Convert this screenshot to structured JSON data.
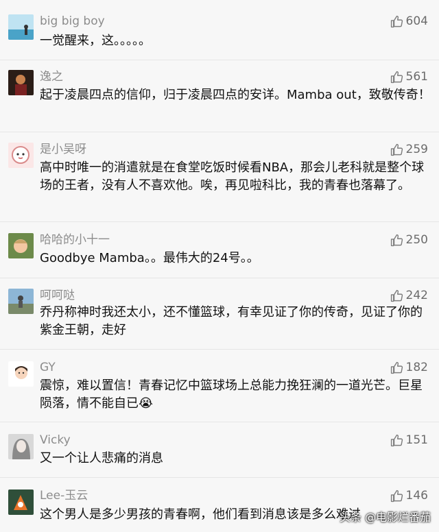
{
  "comments": [
    {
      "user": "big big boy",
      "likes": "604",
      "text": "一觉醒来，这。。。。。"
    },
    {
      "user": "逸之",
      "likes": "561",
      "text": "起于凌晨四点的信仰，归于凌晨四点的安详。Mamba out，致敬传奇！"
    },
    {
      "user": "是小吴呀",
      "likes": "259",
      "text": "高中时唯一的消遣就是在食堂吃饭时候看NBA，那会儿老科就是整个球场的王者，没有人不喜欢他。唉，再见啦科比，我的青春也落幕了。"
    },
    {
      "user": "哈哈的小十一",
      "likes": "250",
      "text": "Goodbye Mamba。。最伟大的24号。。"
    },
    {
      "user": "呵呵哒",
      "likes": "242",
      "text": "乔丹称神时我还太小，还不懂篮球，有幸见证了你的传奇，见证了你的紫金王朝，走好"
    },
    {
      "user": "GY",
      "likes": "182",
      "text": "震惊，难以置信！青春记忆中篮球场上总能力挽狂澜的一道光芒。巨星陨落，情不能自已😭"
    },
    {
      "user": "Vicky",
      "likes": "151",
      "text": "又一个让人悲痛的消息"
    },
    {
      "user": "Lee-玉云",
      "likes": "146",
      "text": "这个男人是多少男孩的青春啊，他们看到消息该是多么难过"
    }
  ],
  "watermark": "头条 @电影烂番茄",
  "colors": {
    "background": "#f7f7f7",
    "username": "#8c8c8c",
    "text": "#111111",
    "likes": "#6b6b6b"
  }
}
